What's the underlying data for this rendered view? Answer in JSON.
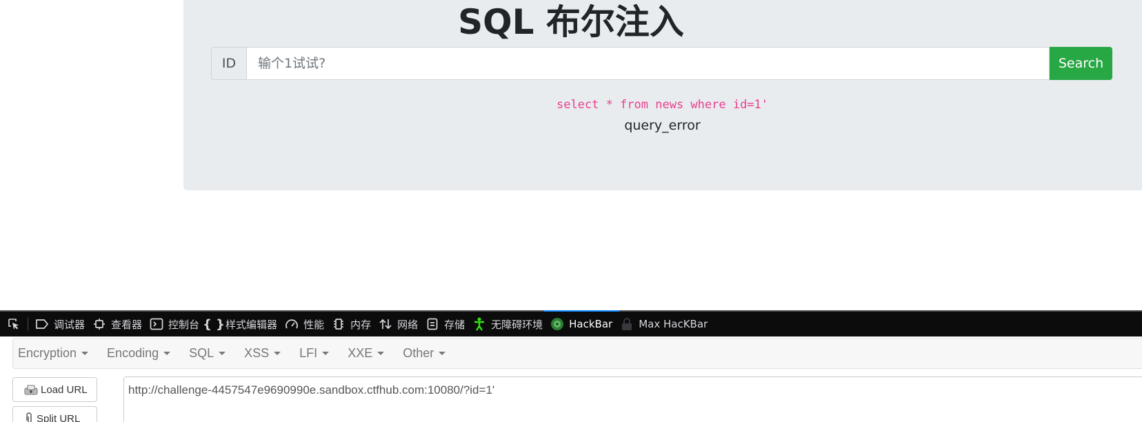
{
  "page": {
    "title": "SQL 布尔注入",
    "search": {
      "prepend_label": "ID",
      "placeholder": "输个1试试?",
      "button_label": "Search"
    },
    "sql_query": "select * from news where id=1'",
    "result_text": "query_error"
  },
  "devtools": {
    "tabs": [
      {
        "icon": "debugger-icon",
        "label": "调试器"
      },
      {
        "icon": "inspector-icon",
        "label": "查看器"
      },
      {
        "icon": "console-icon",
        "label": "控制台"
      },
      {
        "icon": "style-editor-icon",
        "label": "样式编辑器"
      },
      {
        "icon": "performance-icon",
        "label": "性能"
      },
      {
        "icon": "memory-icon",
        "label": "内存"
      },
      {
        "icon": "network-icon",
        "label": "网络"
      },
      {
        "icon": "storage-icon",
        "label": "存储"
      },
      {
        "icon": "accessibility-icon",
        "label": "无障碍环境"
      },
      {
        "icon": "hackbar-icon",
        "label": "HackBar",
        "active": true
      },
      {
        "icon": "lock-icon",
        "label": "Max HacKBar"
      }
    ]
  },
  "hackbar": {
    "menus": [
      "Encryption",
      "Encoding",
      "SQL",
      "XSS",
      "LFI",
      "XXE",
      "Other"
    ],
    "load_url_label": "Load URL",
    "split_url_label": "Split URL",
    "url_value": "http://challenge-4457547e9690990e.sandbox.ctfhub.com:10080/?id=1'"
  },
  "colors": {
    "accent_green": "#28a745",
    "code_pink": "#e83e8c",
    "jumbotron_bg": "#e9ecef",
    "devtools_bg": "#0c0c0d",
    "active_tab_underline": "#0a84ff",
    "accessibility_green": "#30e60b"
  }
}
